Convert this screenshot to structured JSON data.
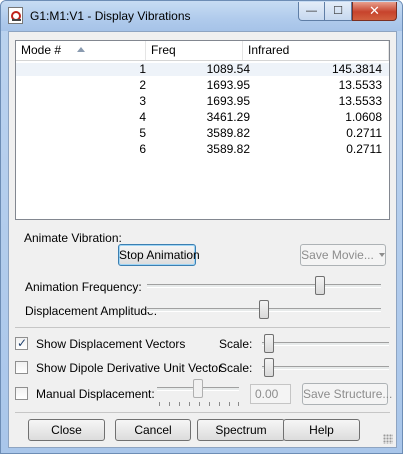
{
  "window": {
    "title": "G1:M1:V1 - Display Vibrations",
    "minimize_glyph": "—",
    "maximize_glyph": "☐",
    "close_glyph": "✕",
    "icon": "gaussview-document-icon"
  },
  "table": {
    "columns": [
      "Mode #",
      "Freq",
      "Infrared"
    ],
    "sort_column": "Mode #",
    "rows": [
      {
        "mode": "1",
        "freq": "1089.54",
        "ir": "145.3814"
      },
      {
        "mode": "2",
        "freq": "1693.95",
        "ir": "13.5533"
      },
      {
        "mode": "3",
        "freq": "1693.95",
        "ir": "13.5533"
      },
      {
        "mode": "4",
        "freq": "3461.29",
        "ir": "1.0608"
      },
      {
        "mode": "5",
        "freq": "3589.82",
        "ir": "0.2711"
      },
      {
        "mode": "6",
        "freq": "3589.82",
        "ir": "0.2711"
      }
    ]
  },
  "animate": {
    "section_label": "Animate Vibration:",
    "stop_button": "Stop Animation",
    "save_movie_button": "Save Movie...",
    "frequency_label": "Animation Frequency:",
    "frequency_level": 0.75,
    "amplitude_label": "Displacement Amplitude:",
    "amplitude_level": 0.5
  },
  "options": {
    "show_displacement_vectors": {
      "label": "Show Displacement Vectors",
      "checked": true,
      "scale_label": "Scale:",
      "scale_level": 0.02
    },
    "show_dipole_vector": {
      "label": "Show Dipole Derivative Unit Vector",
      "checked": false,
      "scale_label": "Scale:",
      "scale_level": 0.02
    },
    "manual_displacement": {
      "label": "Manual Displacement:",
      "checked": false,
      "slider_level": 0.5,
      "value": "0.00",
      "save_structure_button": "Save Structure..."
    }
  },
  "buttons": {
    "close": "Close",
    "cancel": "Cancel",
    "spectrum": "Spectrum",
    "help": "Help"
  }
}
